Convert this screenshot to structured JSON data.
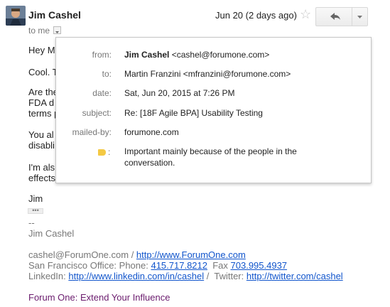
{
  "header": {
    "sender": "Jim Cashel",
    "date": "Jun 20 (2 days ago)",
    "to_me": "to me",
    "star": "☆",
    "reply_icon": "reply-icon",
    "more_icon": "chevron-down-icon"
  },
  "body": {
    "line_hey": "Hey M",
    "line_cool": "Cool. T",
    "line_are1": "Are the",
    "line_are2": "FDA d",
    "line_are3": "terms p",
    "line_you1": "You al",
    "line_you2": "disabli",
    "line_im1": "I'm als",
    "line_im2": "effects",
    "closing": "Jim",
    "ellipsis": "•••"
  },
  "signature": {
    "dashes": "--",
    "name": "Jim Cashel",
    "email": "cashel@ForumOne.com",
    "slash1": " / ",
    "website": "http://www.ForumOne.com",
    "office_prefix": "San Francisco Office: Phone: ",
    "phone": "415.717.8212",
    "fax_prefix": "  Fax ",
    "fax": "703.995.4937",
    "linkedin_prefix": "LinkedIn: ",
    "linkedin": "http://www.linkedin.com/in/cashel",
    "twitter_prefix": " /  Twitter: ",
    "twitter": "http://twitter.com/cashel",
    "tagline": "Forum One: Extend Your Influence"
  },
  "details": {
    "from_label": "from:",
    "from_name": "Jim Cashel",
    "from_email": " <cashel@forumone.com>",
    "to_label": "to:",
    "to_value": "Martin Franzini <mfranzini@forumone.com>",
    "date_label": "date:",
    "date_value": "Sat, Jun 20, 2015 at 7:26 PM",
    "subject_label": "subject:",
    "subject_value": "Re: [18F Agile BPA] Usability Testing",
    "mailedby_label": "mailed-by:",
    "mailedby_value": "forumone.com",
    "importance_colon": ":",
    "importance_line1": "Important mainly because of the people in the",
    "importance_line2": "conversation.",
    "importance_color": "#f4c944"
  }
}
